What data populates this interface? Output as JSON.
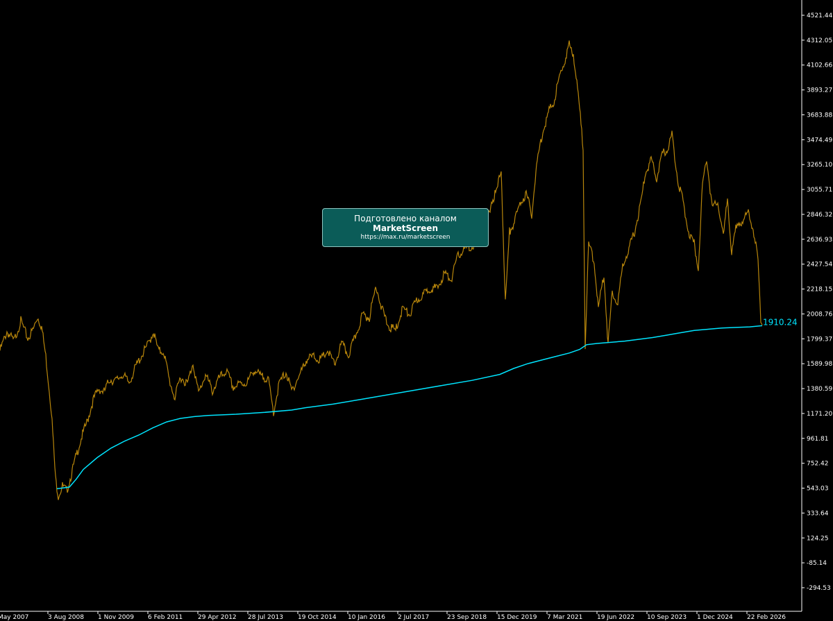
{
  "chart_data": {
    "type": "line",
    "y_ticks": [
      4521.44,
      4312.05,
      4102.66,
      3893.27,
      3683.88,
      3474.49,
      3265.1,
      3055.71,
      2846.32,
      2636.93,
      2427.54,
      2218.15,
      2008.76,
      1799.37,
      1589.98,
      1380.59,
      1171.2,
      961.81,
      752.42,
      543.03,
      333.64,
      124.25,
      -85.14,
      -294.53
    ],
    "y_tick_labels": [
      "4521.44",
      "4312.05",
      "4102.66",
      "3893.27",
      "3683.88",
      "3474.49",
      "3265.10",
      "3055.71",
      "2846.32",
      "2636.93",
      "2427.54",
      "2218.15",
      "2008.76",
      "1799.37",
      "1589.98",
      "1380.59",
      "1171.20",
      "961.81",
      "752.42",
      "543.03",
      "333.64",
      "124.25",
      "-85.14",
      "-294.53"
    ],
    "x_tick_labels": [
      "May 2007",
      "3 Aug 2008",
      "1 Nov 2009",
      "6 Feb 2011",
      "29 Apr 2012",
      "28 Jul 2013",
      "19 Oct 2014",
      "10 Jan 2016",
      "2 Jul 2017",
      "23 Sep 2018",
      "15 Dec 2019",
      "7 Mar 2021",
      "19 Jun 2022",
      "10 Sep 2023",
      "1 Dec 2024",
      "22 Feb 2026"
    ],
    "ylim": [
      -380,
      4620
    ],
    "last_value_label": "1910.24",
    "series": [
      {
        "color": "#b8860b",
        "points": [
          [
            0,
            1700
          ],
          [
            10,
            1860
          ],
          [
            20,
            1780
          ],
          [
            30,
            1950
          ],
          [
            40,
            1800
          ],
          [
            48,
            1880
          ],
          [
            54,
            1985
          ],
          [
            60,
            1900
          ],
          [
            66,
            1650
          ],
          [
            74,
            1200
          ],
          [
            80,
            620
          ],
          [
            84,
            480
          ],
          [
            90,
            560
          ],
          [
            96,
            520
          ],
          [
            102,
            640
          ],
          [
            110,
            820
          ],
          [
            118,
            980
          ],
          [
            126,
            1110
          ],
          [
            134,
            1280
          ],
          [
            142,
            1380
          ],
          [
            150,
            1350
          ],
          [
            158,
            1460
          ],
          [
            166,
            1440
          ],
          [
            176,
            1500
          ],
          [
            186,
            1430
          ],
          [
            196,
            1570
          ],
          [
            206,
            1680
          ],
          [
            214,
            1760
          ],
          [
            221,
            1860
          ],
          [
            228,
            1700
          ],
          [
            236,
            1690
          ],
          [
            244,
            1450
          ],
          [
            252,
            1300
          ],
          [
            260,
            1480
          ],
          [
            270,
            1420
          ],
          [
            278,
            1600
          ],
          [
            286,
            1340
          ],
          [
            296,
            1500
          ],
          [
            306,
            1360
          ],
          [
            316,
            1470
          ],
          [
            326,
            1530
          ],
          [
            336,
            1390
          ],
          [
            346,
            1420
          ],
          [
            356,
            1430
          ],
          [
            366,
            1540
          ],
          [
            376,
            1480
          ],
          [
            386,
            1470
          ],
          [
            394,
            1180
          ],
          [
            402,
            1420
          ],
          [
            412,
            1520
          ],
          [
            420,
            1360
          ],
          [
            432,
            1500
          ],
          [
            442,
            1630
          ],
          [
            452,
            1650
          ],
          [
            462,
            1620
          ],
          [
            472,
            1700
          ],
          [
            482,
            1580
          ],
          [
            492,
            1760
          ],
          [
            502,
            1660
          ],
          [
            512,
            1820
          ],
          [
            522,
            2000
          ],
          [
            532,
            1980
          ],
          [
            542,
            2250
          ],
          [
            550,
            2050
          ],
          [
            560,
            1900
          ],
          [
            570,
            1870
          ],
          [
            580,
            2060
          ],
          [
            590,
            2000
          ],
          [
            600,
            2120
          ],
          [
            610,
            2170
          ],
          [
            620,
            2230
          ],
          [
            630,
            2220
          ],
          [
            640,
            2350
          ],
          [
            650,
            2300
          ],
          [
            660,
            2500
          ],
          [
            670,
            2560
          ],
          [
            680,
            2570
          ],
          [
            690,
            2650
          ],
          [
            700,
            2750
          ],
          [
            708,
            2950
          ],
          [
            716,
            3050
          ],
          [
            722,
            3230
          ],
          [
            728,
            2100
          ],
          [
            734,
            2700
          ],
          [
            742,
            2800
          ],
          [
            750,
            2950
          ],
          [
            758,
            3020
          ],
          [
            766,
            2850
          ],
          [
            774,
            3300
          ],
          [
            782,
            3550
          ],
          [
            790,
            3700
          ],
          [
            798,
            3800
          ],
          [
            806,
            4000
          ],
          [
            814,
            4150
          ],
          [
            820,
            4270
          ],
          [
            826,
            4200
          ],
          [
            834,
            3800
          ],
          [
            840,
            3400
          ],
          [
            843,
            1740
          ],
          [
            848,
            2600
          ],
          [
            856,
            2450
          ],
          [
            862,
            2050
          ],
          [
            870,
            2350
          ],
          [
            876,
            1750
          ],
          [
            882,
            2200
          ],
          [
            890,
            2100
          ],
          [
            898,
            2450
          ],
          [
            906,
            2550
          ],
          [
            914,
            2700
          ],
          [
            922,
            2900
          ],
          [
            930,
            3200
          ],
          [
            938,
            3300
          ],
          [
            946,
            3150
          ],
          [
            954,
            3350
          ],
          [
            962,
            3400
          ],
          [
            968,
            3520
          ],
          [
            976,
            3150
          ],
          [
            984,
            2950
          ],
          [
            992,
            2700
          ],
          [
            1000,
            2600
          ],
          [
            1006,
            2400
          ],
          [
            1012,
            3100
          ],
          [
            1018,
            3320
          ],
          [
            1026,
            2900
          ],
          [
            1034,
            2950
          ],
          [
            1042,
            2650
          ],
          [
            1048,
            3000
          ],
          [
            1054,
            2500
          ],
          [
            1062,
            2800
          ],
          [
            1070,
            2750
          ],
          [
            1078,
            2900
          ],
          [
            1086,
            2650
          ],
          [
            1092,
            2500
          ],
          [
            1096,
            1960
          ],
          [
            1098,
            1915
          ]
        ]
      },
      {
        "color": "#00e5ff",
        "points": [
          [
            82,
            538
          ],
          [
            100,
            552
          ],
          [
            110,
            620
          ],
          [
            120,
            700
          ],
          [
            140,
            800
          ],
          [
            160,
            880
          ],
          [
            180,
            940
          ],
          [
            200,
            990
          ],
          [
            220,
            1050
          ],
          [
            240,
            1100
          ],
          [
            260,
            1130
          ],
          [
            280,
            1145
          ],
          [
            300,
            1155
          ],
          [
            340,
            1165
          ],
          [
            380,
            1180
          ],
          [
            420,
            1200
          ],
          [
            440,
            1220
          ],
          [
            480,
            1250
          ],
          [
            520,
            1290
          ],
          [
            560,
            1330
          ],
          [
            600,
            1370
          ],
          [
            640,
            1410
          ],
          [
            680,
            1450
          ],
          [
            720,
            1500
          ],
          [
            740,
            1550
          ],
          [
            760,
            1590
          ],
          [
            780,
            1620
          ],
          [
            800,
            1650
          ],
          [
            820,
            1680
          ],
          [
            835,
            1710
          ],
          [
            845,
            1750
          ],
          [
            860,
            1760
          ],
          [
            900,
            1780
          ],
          [
            940,
            1810
          ],
          [
            960,
            1830
          ],
          [
            980,
            1850
          ],
          [
            1000,
            1870
          ],
          [
            1020,
            1880
          ],
          [
            1040,
            1890
          ],
          [
            1060,
            1895
          ],
          [
            1080,
            1900
          ],
          [
            1098,
            1910
          ]
        ]
      }
    ]
  },
  "banner": {
    "line1": "Подготовлено каналом",
    "line2": "MarketScreen",
    "line3": "https://max.ru/marketscreen"
  },
  "colors": {
    "background": "#000000",
    "price": "#b8860b",
    "ma": "#00e5ff",
    "axis": "#ffffff",
    "banner_bg": "#0b5c58"
  }
}
